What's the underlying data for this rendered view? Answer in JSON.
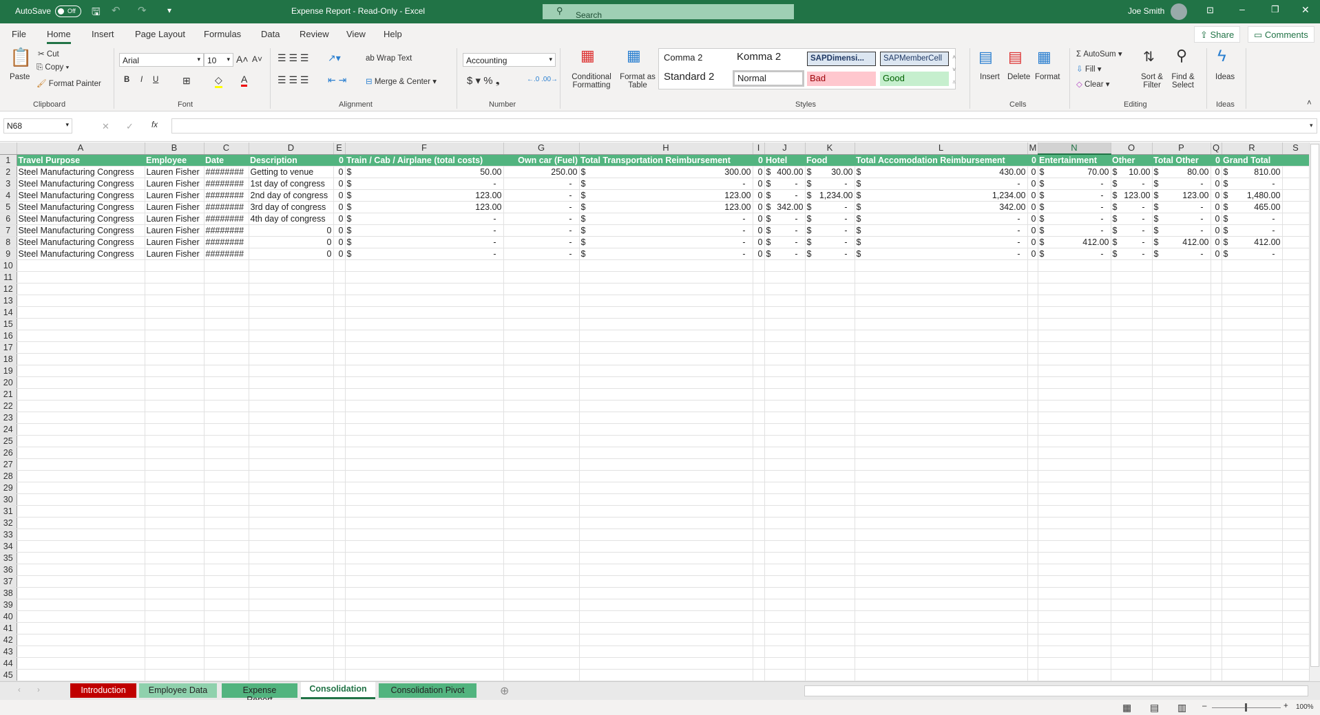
{
  "titlebar": {
    "autosave": "AutoSave",
    "autosave_state": "Off",
    "title": "Expense Report  -  Read-Only  -  Excel",
    "search": "Search",
    "user": "Joe Smith"
  },
  "menu": {
    "tabs": [
      "File",
      "Home",
      "Insert",
      "Page Layout",
      "Formulas",
      "Data",
      "Review",
      "View",
      "Help"
    ],
    "share": "Share",
    "comments": "Comments"
  },
  "ribbon": {
    "clipboard": {
      "paste": "Paste",
      "cut": "Cut",
      "copy": "Copy",
      "format_painter": "Format Painter",
      "label": "Clipboard"
    },
    "font": {
      "name": "Arial",
      "size": "10",
      "bold": "B",
      "italic": "I",
      "underline": "U",
      "label": "Font"
    },
    "alignment": {
      "wrap": "Wrap Text",
      "merge": "Merge & Center",
      "label": "Alignment"
    },
    "number": {
      "format": "Accounting",
      "label": "Number"
    },
    "styles": {
      "conditional": "Conditional Formatting",
      "format_table": "Format as Table",
      "items": [
        "Comma 2",
        "Komma 2",
        "SAPDimensi...",
        "SAPMemberCell",
        "Standard 2",
        "Normal",
        "Bad",
        "Good"
      ],
      "label": "Styles"
    },
    "cells": {
      "insert": "Insert",
      "delete": "Delete",
      "format": "Format",
      "label": "Cells"
    },
    "editing": {
      "autosum": "AutoSum",
      "fill": "Fill",
      "clear": "Clear",
      "sort": "Sort & Filter",
      "find": "Find & Select",
      "label": "Editing"
    },
    "ideas": {
      "ideas": "Ideas",
      "label": "Ideas"
    }
  },
  "formula_bar": {
    "name_box": "N68",
    "fx": "fx",
    "value": ""
  },
  "sheet": {
    "currency_symbol": "$",
    "columns": [
      "A",
      "B",
      "C",
      "D",
      "E",
      "F",
      "G",
      "H",
      "I",
      "J",
      "K",
      "L",
      "M",
      "N",
      "O",
      "P",
      "Q",
      "R",
      "S"
    ],
    "selected_column": "N",
    "header": [
      "Travel Purpose",
      "Employee",
      "Date",
      "Description",
      "0",
      "Train / Cab / Airplane (total costs)",
      "Own car (Fuel)",
      "Total Transportation Reimbursement",
      "0",
      "Hotel",
      "Food",
      "Total Accomodation Reimbursement",
      "0",
      "Entertainment",
      "Other",
      "Total Other",
      "0",
      "Grand Total",
      ""
    ],
    "rows": [
      [
        "Steel Manufacturing Congress",
        "Lauren Fisher",
        "########",
        "Getting to venue",
        "0",
        "50.00",
        "250.00",
        "300.00",
        "0",
        "400.00",
        "30.00",
        "430.00",
        "0",
        "70.00",
        "10.00",
        "80.00",
        "0",
        "810.00",
        ""
      ],
      [
        "Steel Manufacturing Congress",
        "Lauren Fisher",
        "########",
        "1st day of congress",
        "0",
        "-",
        "-",
        "-",
        "0",
        "-",
        "-",
        "-",
        "0",
        "-",
        "-",
        "-",
        "0",
        "-",
        ""
      ],
      [
        "Steel Manufacturing Congress",
        "Lauren Fisher",
        "########",
        "2nd day of congress",
        "0",
        "123.00",
        "-",
        "123.00",
        "0",
        "-",
        "1,234.00",
        "1,234.00",
        "0",
        "-",
        "123.00",
        "123.00",
        "0",
        "1,480.00",
        ""
      ],
      [
        "Steel Manufacturing Congress",
        "Lauren Fisher",
        "########",
        "3rd day of congress",
        "0",
        "123.00",
        "-",
        "123.00",
        "0",
        "342.00",
        "-",
        "342.00",
        "0",
        "-",
        "-",
        "-",
        "0",
        "465.00",
        ""
      ],
      [
        "Steel Manufacturing Congress",
        "Lauren Fisher",
        "########",
        "4th day of congress",
        "0",
        "-",
        "-",
        "-",
        "0",
        "-",
        "-",
        "-",
        "0",
        "-",
        "-",
        "-",
        "0",
        "-",
        ""
      ],
      [
        "Steel Manufacturing Congress",
        "Lauren Fisher",
        "########",
        "0",
        "0",
        "-",
        "-",
        "-",
        "0",
        "-",
        "-",
        "-",
        "0",
        "-",
        "-",
        "-",
        "0",
        "-",
        ""
      ],
      [
        "Steel Manufacturing Congress",
        "Lauren Fisher",
        "########",
        "0",
        "0",
        "-",
        "-",
        "-",
        "0",
        "-",
        "-",
        "-",
        "0",
        "412.00",
        "-",
        "412.00",
        "0",
        "412.00",
        ""
      ],
      [
        "Steel Manufacturing Congress",
        "Lauren Fisher",
        "########",
        "0",
        "0",
        "-",
        "-",
        "-",
        "0",
        "-",
        "-",
        "-",
        "0",
        "-",
        "-",
        "-",
        "0",
        "-",
        ""
      ]
    ],
    "total_rows": 45
  },
  "sheet_tabs": [
    {
      "label": "Introduction",
      "color": "#c00000",
      "text": "#ffffff"
    },
    {
      "label": "Employee Data",
      "color": "#8fd1ad",
      "text": "#222222"
    },
    {
      "label": "Expense Report",
      "color": "#52b47f",
      "text": "#222222"
    },
    {
      "label": "Consolidation",
      "color": "#ffffff",
      "text": "#217346",
      "active": true
    },
    {
      "label": "Consolidation Pivot",
      "color": "#52b47f",
      "text": "#222222"
    }
  ],
  "status": {
    "zoom": "100%"
  }
}
